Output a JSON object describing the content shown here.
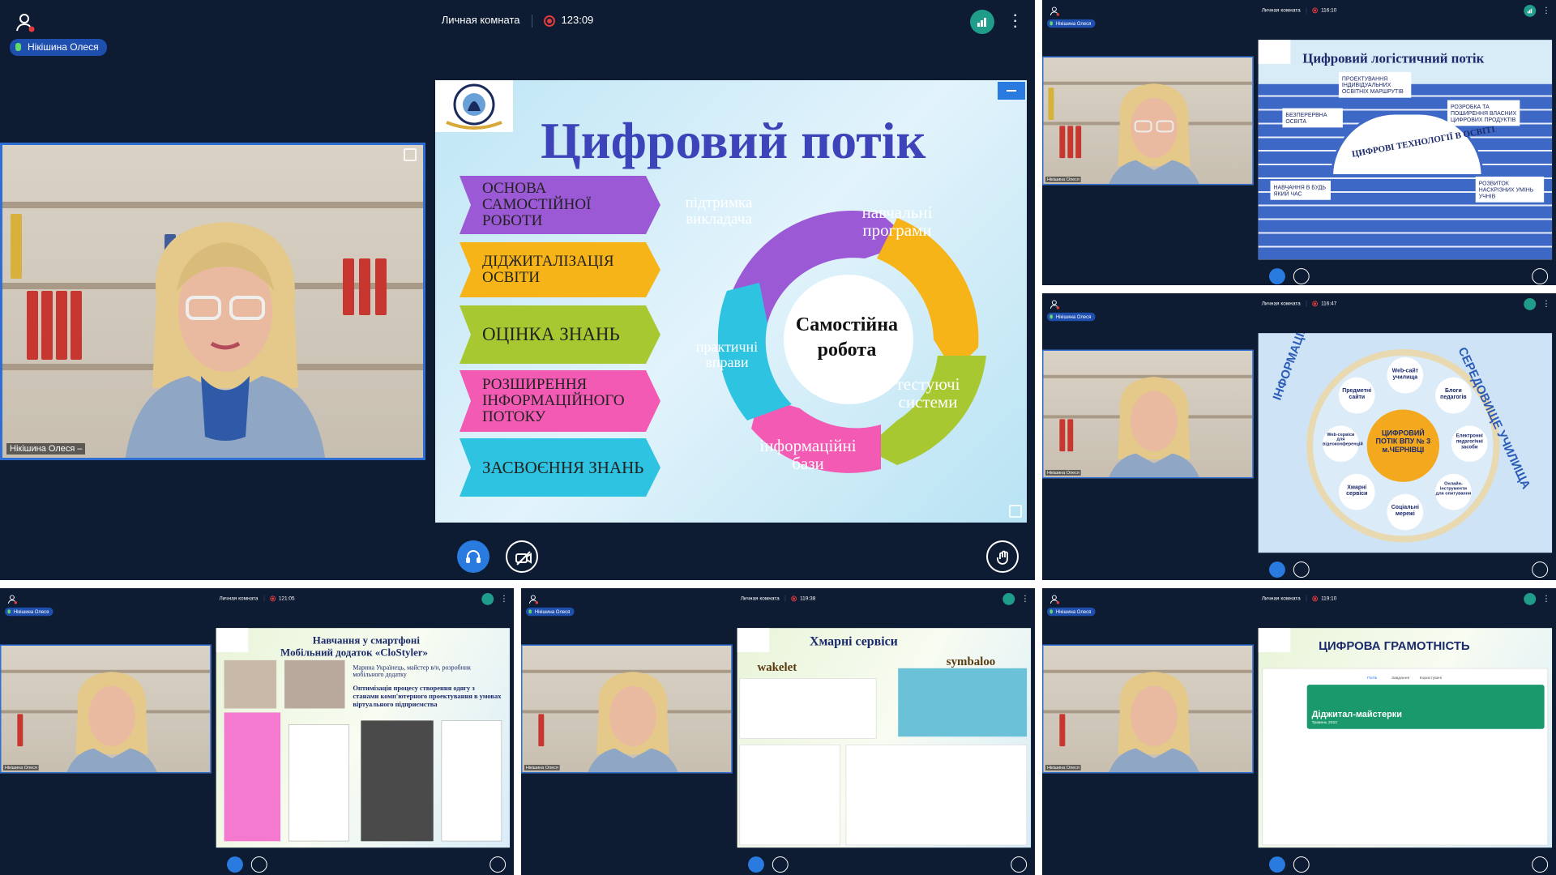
{
  "app": {
    "room_title": "Личная комната",
    "participant_name": "Нікішина Олеся",
    "camera_label": "Нікішина Олеся –",
    "accent_color": "#2a7be0",
    "signal_color": "#1f9c8a",
    "record_color": "#e23b3b"
  },
  "tiles": [
    {
      "timer": "123:09"
    },
    {
      "timer": "116:10"
    },
    {
      "timer": "116:47"
    },
    {
      "timer": "121:05"
    },
    {
      "timer": "119:38"
    },
    {
      "timer": "119:10"
    }
  ],
  "slide_main": {
    "title": "Цифровий потік",
    "chevrons": [
      {
        "text": "ОСНОВА САМОСТІЙНОЇ РОБОТИ",
        "color": "#9b59d6"
      },
      {
        "text": "ДІДЖИТАЛІЗАЦІЯ ОСВІТИ",
        "color": "#f7b418"
      },
      {
        "text": "ОЦІНКА ЗНАНЬ",
        "color": "#a8c832"
      },
      {
        "text": "РОЗШИРЕННЯ ІНФОРМАЦІЙНОГО ПОТОКУ",
        "color": "#f25ab4"
      },
      {
        "text": "ЗАСВОЄННЯ ЗНАНЬ",
        "color": "#2ec3e0"
      }
    ],
    "wheel": {
      "center": "Самостійна робота",
      "segments": [
        {
          "text": "підтримка викладача",
          "color": "#9b59d6"
        },
        {
          "text": "навчальні програми",
          "color": "#f7b418"
        },
        {
          "text": "тестуючі системи",
          "color": "#a8c832"
        },
        {
          "text": "інформаційні бази",
          "color": "#f25ab4"
        },
        {
          "text": "практичні вправи",
          "color": "#2ec3e0"
        }
      ]
    }
  },
  "slide_r1": {
    "title": "Цифровий логістичний потік",
    "banner": "ЦИФРОВІ ТЕХНОЛОГІЇ В ОСВІТІ",
    "items": [
      "ПРОЕКТУВАННЯ ІНДИВІДУАЛЬНИХ ОСВІТНІХ МАРШРУТІВ",
      "БЕЗПЕРЕРВНА ОСВІТА",
      "РОЗРОБКА ТА ПОШИРЕННЯ ВЛАСНИХ ЦИФРОВИХ ПРОДУКТІВ",
      "НАВЧАННЯ В БУДЬ ЯКИЙ ЧАС",
      "РОЗВИТОК НАСКРІЗНИХ УМІНЬ УЧНІВ"
    ]
  },
  "slide_r2": {
    "arc_left": "ІНФОРМАЦІЙНЕ ОСВІТНЄ",
    "arc_right": "СЕРЕДОВИЩЕ УЧИЛИЩА",
    "center": "ЦИФРОВИЙ ПОТІК ВПУ № 3 м.ЧЕРНІВЦІ",
    "items": [
      "Web-сайт училища",
      "Блоги педагогів",
      "Електронні педагогічні засоби",
      "Онлайн-інструменти для опитування",
      "Соціальні мережі",
      "Хмарні сервіси",
      "Web-сервіси для відеоконференцій",
      "Предметні сайти"
    ]
  },
  "slide_b1": {
    "title1": "Навчання у смартфоні",
    "title2": "Мобільний додаток «CloStyler»",
    "author": "Марина Українець, майстер в/н, розробник мобільного додатку",
    "subtitle": "Оптимізація процесу створення одягу з станами комп'ютерного проектування в умовах віртуального підприємства"
  },
  "slide_b2": {
    "title": "Хмарні сервіси",
    "left_label": "wakelet",
    "right_label": "symbaloo"
  },
  "slide_b3": {
    "title": "ЦИФРОВА ГРАМОТНІСТЬ",
    "banner_title": "Діджитал-майстерки",
    "banner_date": "Травень 2022",
    "tabs": [
      "Потік",
      "Завдання",
      "Користувачі"
    ]
  }
}
